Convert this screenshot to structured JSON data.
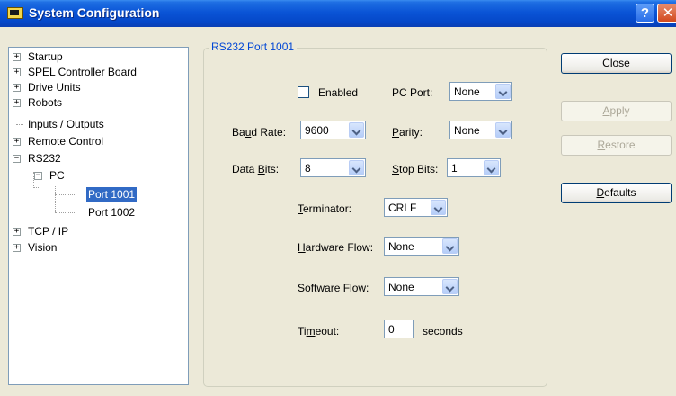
{
  "window": {
    "title": "System Configuration",
    "help_glyph": "?",
    "close_glyph": "✕"
  },
  "tree": {
    "items": [
      {
        "label": "Startup",
        "expander": "+"
      },
      {
        "label": "SPEL Controller Board",
        "expander": "+"
      },
      {
        "label": "Drive Units",
        "expander": "+"
      },
      {
        "label": "Robots",
        "expander": "+"
      },
      {
        "label": "Inputs / Outputs",
        "expander": ""
      },
      {
        "label": "Remote Control",
        "expander": "+"
      },
      {
        "label": "RS232",
        "expander": "−"
      },
      {
        "label": "PC",
        "expander": "−"
      },
      {
        "label": "Port 1001",
        "expander": "",
        "selected": true
      },
      {
        "label": "Port 1002",
        "expander": ""
      },
      {
        "label": "TCP / IP",
        "expander": "+"
      },
      {
        "label": "Vision",
        "expander": "+"
      }
    ]
  },
  "group": {
    "title": "RS232 Port 1001",
    "enabled_label": "Enabled",
    "enabled_checked": false,
    "pc_port": {
      "label": "PC Port:",
      "value": "None"
    },
    "baud_rate": {
      "label_pre": "Ba",
      "label_u": "u",
      "label_post": "d Rate:",
      "value": "9600"
    },
    "parity": {
      "label_u": "P",
      "label_post": "arity:",
      "value": "None"
    },
    "data_bits": {
      "label_pre": "Data ",
      "label_u": "B",
      "label_post": "its:",
      "value": "8"
    },
    "stop_bits": {
      "label_u": "S",
      "label_post": "top Bits:",
      "value": "1"
    },
    "terminator": {
      "label_u": "T",
      "label_post": "erminator:",
      "value": "CRLF"
    },
    "hardware_flow": {
      "label_u": "H",
      "label_post": "ardware Flow:",
      "value": "None"
    },
    "software_flow": {
      "label_pre": "S",
      "label_u": "o",
      "label_post": "ftware Flow:",
      "value": "None"
    },
    "timeout": {
      "label_pre": "Ti",
      "label_u": "m",
      "label_post": "eout:",
      "value": "0",
      "unit": "seconds"
    }
  },
  "buttons": {
    "close": "Close",
    "apply": {
      "u": "A",
      "rest": "pply"
    },
    "restore": {
      "u": "R",
      "rest": "estore"
    },
    "defaults": {
      "u": "D",
      "rest": "efaults"
    }
  }
}
